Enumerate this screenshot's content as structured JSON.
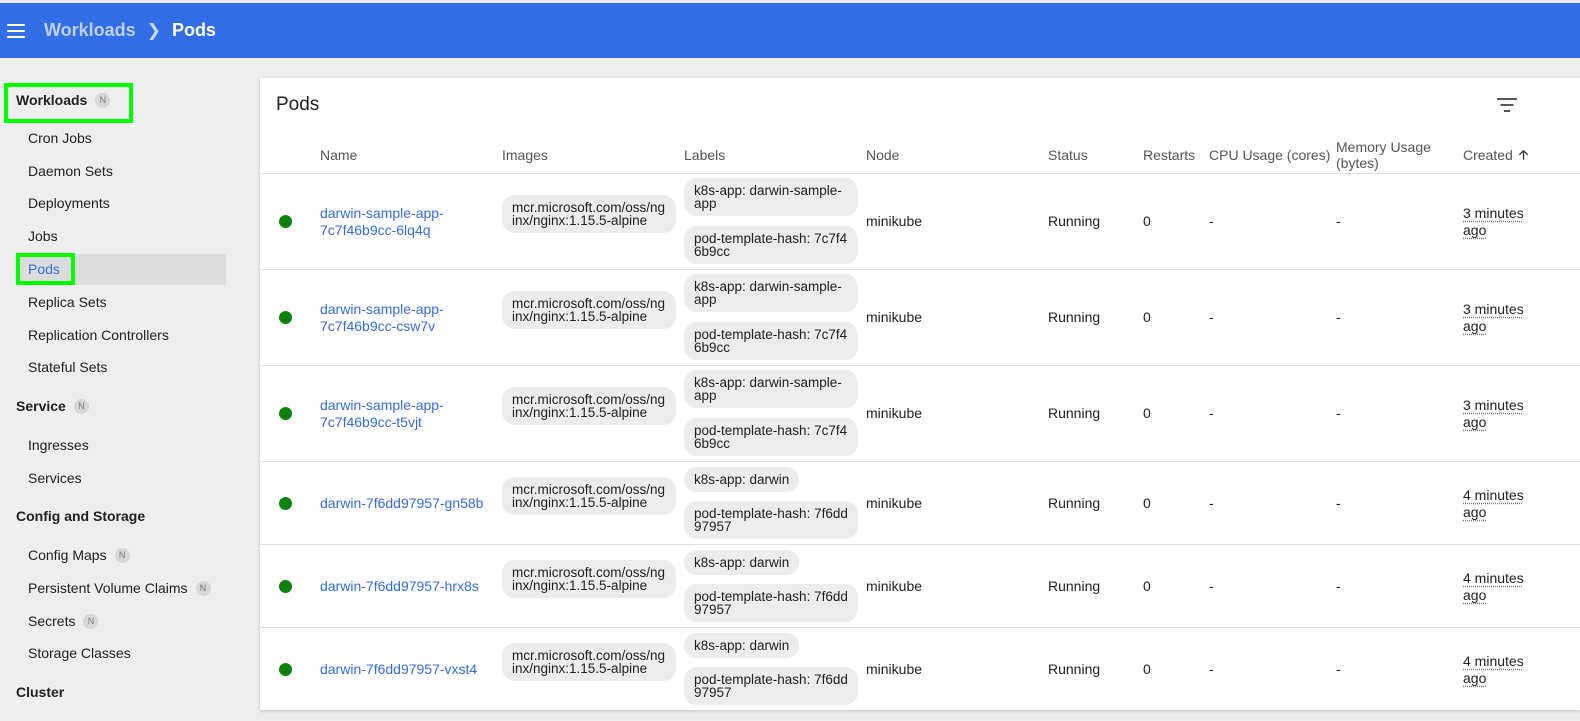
{
  "header": {
    "breadcrumb_parent": "Workloads",
    "breadcrumb_current": "Pods",
    "menu_icon": "hamburger-menu-icon",
    "color": "#326de6"
  },
  "sidebar": {
    "workloads": {
      "label": "Workloads",
      "badge": "N",
      "items": [
        "Cron Jobs",
        "Daemon Sets",
        "Deployments",
        "Jobs",
        "Pods",
        "Replica Sets",
        "Replication Controllers",
        "Stateful Sets"
      ],
      "active": "Pods"
    },
    "service": {
      "label": "Service",
      "badge": "N",
      "items": [
        "Ingresses",
        "Services"
      ]
    },
    "config": {
      "label": "Config and Storage",
      "items": [
        "Config Maps",
        "Persistent Volume Claims",
        "Secrets",
        "Storage Classes"
      ],
      "badge": "N"
    },
    "cluster": {
      "label": "Cluster"
    }
  },
  "card": {
    "title": "Pods",
    "filter_icon": "filter-icon",
    "columns": [
      "Name",
      "Images",
      "Labels",
      "Node",
      "Status",
      "Restarts",
      "CPU Usage (cores)",
      "Memory Usage (bytes)",
      "Created"
    ],
    "sort_icon": "arrow-upward-icon",
    "sort_arrow": "🡡"
  },
  "pods": [
    {
      "name": "darwin-sample-app-7c7f46b9cc-6lq4q",
      "image": "mcr.microsoft.com/oss/nginx/nginx:1.15.5-alpine",
      "labels": [
        "k8s-app: darwin-sample-app",
        "pod-template-hash: 7c7f46b9cc"
      ],
      "node": "minikube",
      "status": "Running",
      "restarts": "0",
      "cpu": "-",
      "memory": "-",
      "created": "3 minutes ago"
    },
    {
      "name": "darwin-sample-app-7c7f46b9cc-csw7v",
      "image": "mcr.microsoft.com/oss/nginx/nginx:1.15.5-alpine",
      "labels": [
        "k8s-app: darwin-sample-app",
        "pod-template-hash: 7c7f46b9cc"
      ],
      "node": "minikube",
      "status": "Running",
      "restarts": "0",
      "cpu": "-",
      "memory": "-",
      "created": "3 minutes ago"
    },
    {
      "name": "darwin-sample-app-7c7f46b9cc-t5vjt",
      "image": "mcr.microsoft.com/oss/nginx/nginx:1.15.5-alpine",
      "labels": [
        "k8s-app: darwin-sample-app",
        "pod-template-hash: 7c7f46b9cc"
      ],
      "node": "minikube",
      "status": "Running",
      "restarts": "0",
      "cpu": "-",
      "memory": "-",
      "created": "3 minutes ago"
    },
    {
      "name": "darwin-7f6dd97957-gn58b",
      "image": "mcr.microsoft.com/oss/nginx/nginx:1.15.5-alpine",
      "labels": [
        "k8s-app: darwin",
        "pod-template-hash: 7f6dd97957"
      ],
      "node": "minikube",
      "status": "Running",
      "restarts": "0",
      "cpu": "-",
      "memory": "-",
      "created": "4 minutes ago"
    },
    {
      "name": "darwin-7f6dd97957-hrx8s",
      "image": "mcr.microsoft.com/oss/nginx/nginx:1.15.5-alpine",
      "labels": [
        "k8s-app: darwin",
        "pod-template-hash: 7f6dd97957"
      ],
      "node": "minikube",
      "status": "Running",
      "restarts": "0",
      "cpu": "-",
      "memory": "-",
      "created": "4 minutes ago"
    },
    {
      "name": "darwin-7f6dd97957-vxst4",
      "image": "mcr.microsoft.com/oss/nginx/nginx:1.15.5-alpine",
      "labels": [
        "k8s-app: darwin",
        "pod-template-hash: 7f6dd97957"
      ],
      "node": "minikube",
      "status": "Running",
      "restarts": "0",
      "cpu": "-",
      "memory": "-",
      "created": "4 minutes ago"
    }
  ],
  "status_color": "#108010",
  "highlight_color": "#00ff00"
}
